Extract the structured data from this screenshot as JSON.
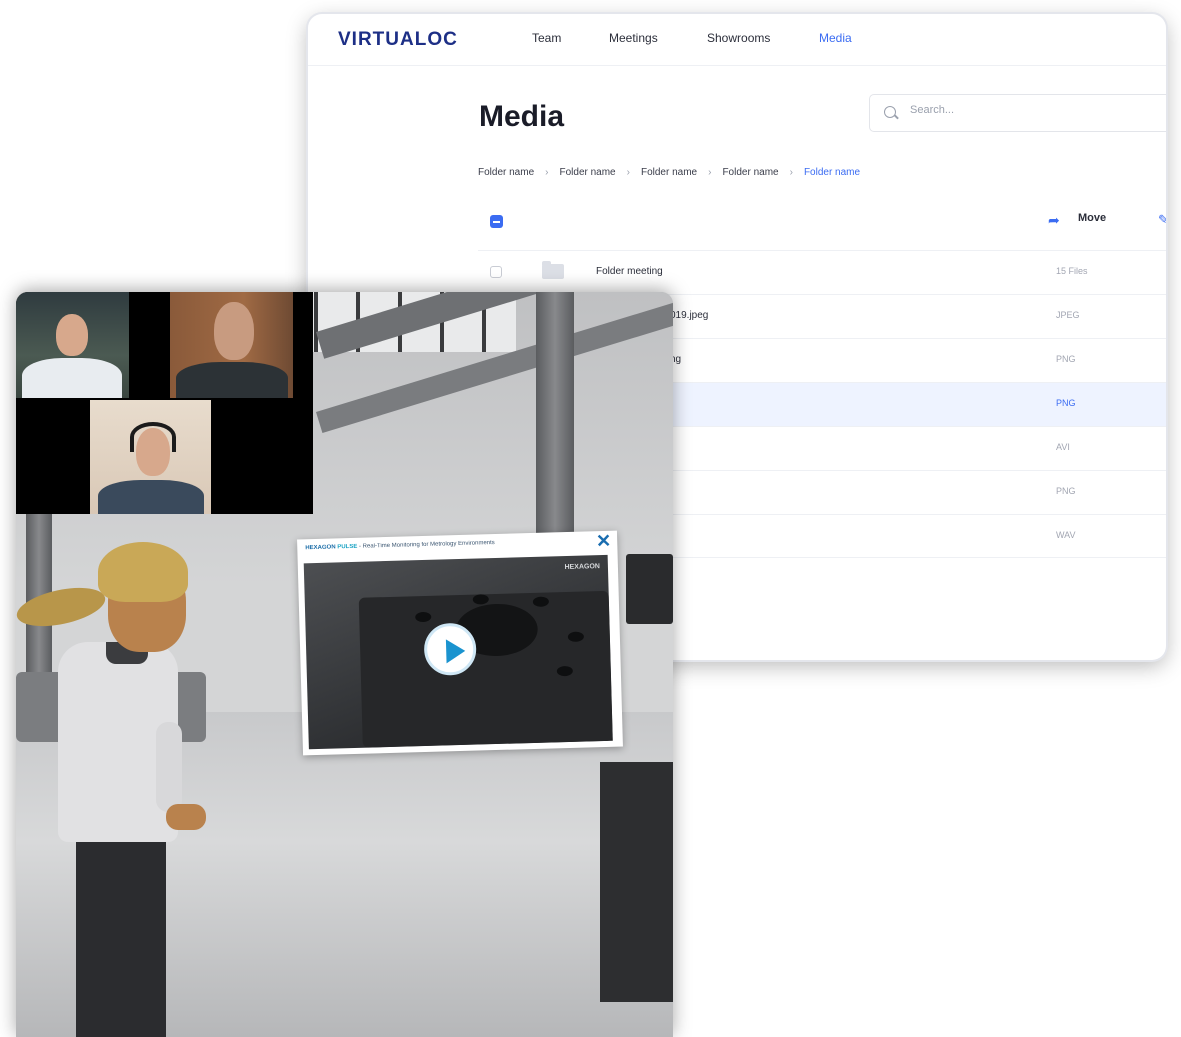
{
  "app": {
    "logo": "VIRTUALOC"
  },
  "nav": {
    "items": [
      {
        "label": "Team"
      },
      {
        "label": "Meetings"
      },
      {
        "label": "Showrooms"
      },
      {
        "label": "Media",
        "active": true
      }
    ]
  },
  "page": {
    "title": "Media"
  },
  "search": {
    "placeholder": "Search..."
  },
  "breadcrumb": [
    "Folder name",
    "Folder name",
    "Folder name",
    "Folder name",
    "Folder name"
  ],
  "toolbar": {
    "move_label": "Move"
  },
  "files": [
    {
      "name": "Folder meeting",
      "meta": "15 Files",
      "type": "folder"
    },
    {
      "name": "019.jpeg",
      "meta": "JPEG"
    },
    {
      "name": "ng",
      "meta": "PNG"
    },
    {
      "name": "",
      "meta": "PNG",
      "selected": true
    },
    {
      "name": "",
      "meta": "AVI"
    },
    {
      "name": "",
      "meta": "PNG"
    },
    {
      "name": "",
      "meta": "WAV"
    }
  ],
  "video_panel": {
    "brand": "HEXAGON",
    "product": "PULSE",
    "title": "- Real-Time Monitoring for Metrology Environments",
    "watermark": "HEXAGON"
  },
  "colors": {
    "accent": "#3b6cf2",
    "logo": "#1d2f86",
    "play": "#1a93cf"
  }
}
